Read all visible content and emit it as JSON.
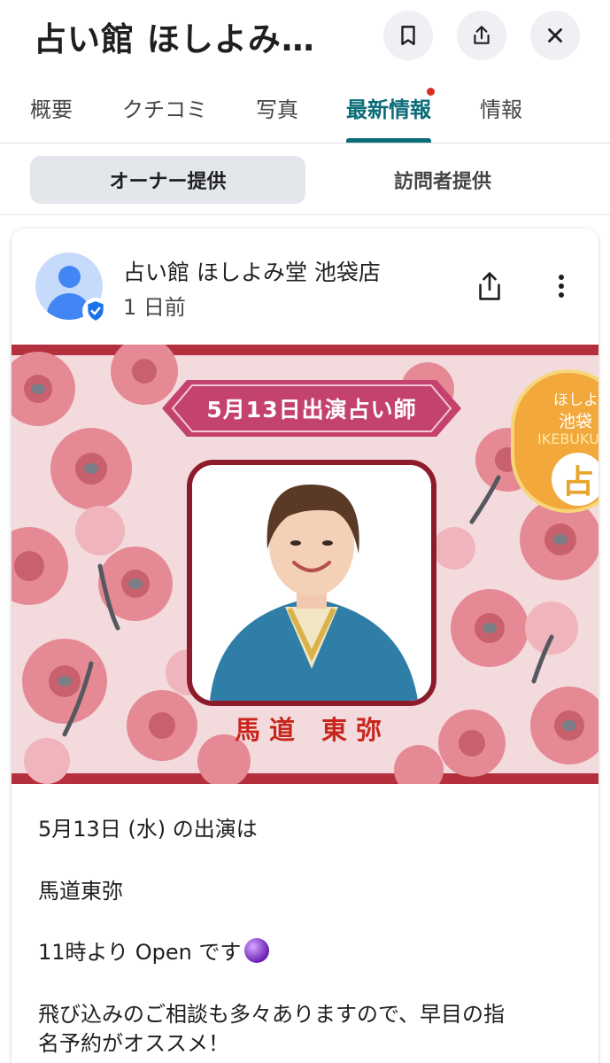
{
  "header": {
    "title": "占い館 ほしよみ…",
    "bookmark_icon": "bookmark-icon",
    "share_icon": "share-icon",
    "close_icon": "close-icon"
  },
  "tabs": [
    {
      "label": "概要"
    },
    {
      "label": "クチコミ"
    },
    {
      "label": "写真"
    },
    {
      "label": "最新情報",
      "active": true,
      "has_notification_dot": true
    },
    {
      "label": "情報"
    }
  ],
  "segments": {
    "owner": "オーナー提供",
    "visitor": "訪問者提供",
    "selected": "owner"
  },
  "post": {
    "business_name": "占い館 ほしよみ堂 池袋店",
    "posted_ago": "1 日前",
    "image": {
      "banner": "5月13日出演占い師",
      "performer": "馬道 東弥",
      "badge_line1": "ほしよみ",
      "badge_line2": "池袋",
      "badge_line3": "IKEBUKU",
      "badge_kanji": "占"
    },
    "lines": [
      "5月13日 (水) の出演は",
      "馬道東弥",
      "11時より Open です",
      "飛び込みのご相談も多々ありますので、早目の指",
      "名予約がオススメ！"
    ]
  },
  "colors": {
    "accent": "#0b6d78",
    "notification_dot": "#d93025",
    "banner": "#c4426e",
    "frame": "#8c1c2c",
    "name_red": "#c8261d"
  }
}
